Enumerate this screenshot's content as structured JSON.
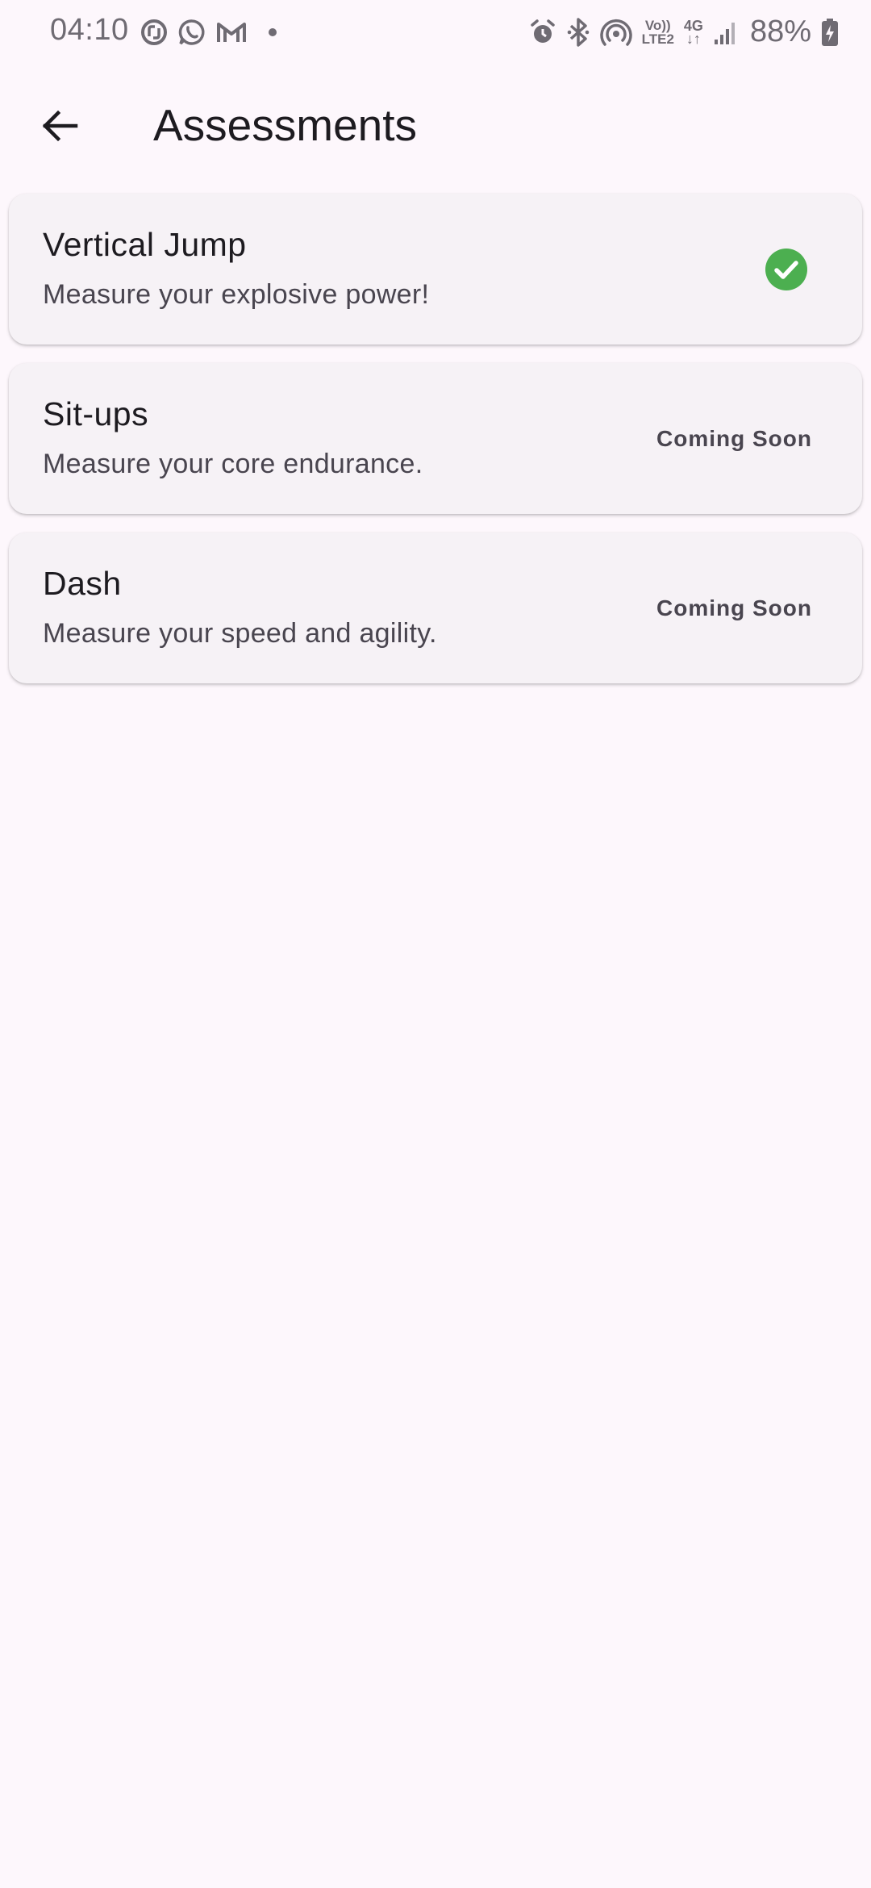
{
  "status_bar": {
    "time": "04:10",
    "left_icons": [
      "sync-app-icon",
      "whatsapp-icon",
      "gmail-icon",
      "notification-dot-icon"
    ],
    "right_icons": [
      "alarm-icon",
      "bluetooth-icon",
      "hotspot-icon",
      "volte-icon",
      "network-4g-icon",
      "signal-icon",
      "battery-charging-icon"
    ],
    "volte_top": "Vo))",
    "volte_bottom": "LTE2",
    "network_type": "4G",
    "battery": "88%"
  },
  "app_bar": {
    "title": "Assessments",
    "back_icon": "arrow-back-icon"
  },
  "assessments": [
    {
      "title": "Vertical Jump",
      "subtitle": "Measure your explosive power!",
      "status": "completed",
      "status_icon": "check-circle-icon",
      "status_color": "#4caf50"
    },
    {
      "title": "Sit-ups",
      "subtitle": "Measure your core endurance.",
      "status": "Coming Soon"
    },
    {
      "title": "Dash",
      "subtitle": "Measure your speed and agility.",
      "status": "Coming Soon"
    }
  ],
  "colors": {
    "background": "#fdf7fc",
    "card": "#f6f2f6",
    "success": "#4caf50"
  }
}
